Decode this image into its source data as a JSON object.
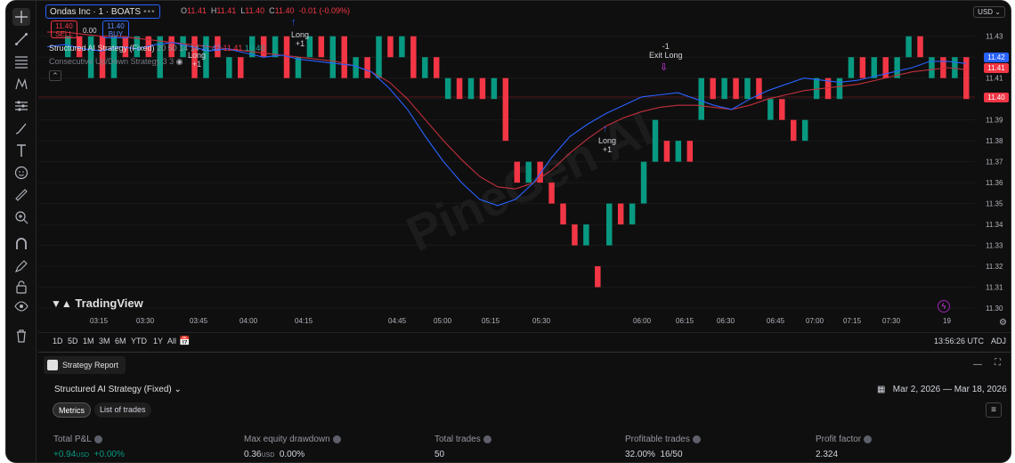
{
  "symbol": {
    "title": "Ondas Inc · 1 · BOATS",
    "ohlc_open_label": "O",
    "ohlc_open": "11.41",
    "ohlc_high_label": "H",
    "ohlc_high": "11.41",
    "ohlc_low_label": "L",
    "ohlc_low": "11.40",
    "ohlc_close_label": "C",
    "ohlc_close": "11.40",
    "change": "-0.01 (-0.09%)"
  },
  "trade": {
    "sell_price": "11.40",
    "sell_label": "SELL",
    "spread": "0.00",
    "buy_price": "11.40",
    "buy_label": "BUY"
  },
  "indicators": {
    "strategy_name": "Structured AI Strategy (Fixed)",
    "strategy_params": "20 50 14 14",
    "strategy_values": [
      "11.42",
      "11.41",
      "10.40"
    ],
    "second_name": "Consecutive Up/Down Strategy 3 3"
  },
  "price_axis": {
    "currency": "USD",
    "ticks": [
      "11.43",
      "11.42",
      "11.41",
      "11.40",
      "11.39",
      "11.38",
      "11.37",
      "11.36",
      "11.35",
      "11.34",
      "11.33",
      "11.32",
      "11.31",
      "11.30"
    ],
    "tag_blue": "11.42",
    "tag_red": "11.41",
    "tag_last": "11.40"
  },
  "time_axis": {
    "labels": [
      "03:15",
      "03:30",
      "03:45",
      "04:00",
      "04:15",
      "04:45",
      "05:00",
      "05:15",
      "05:30",
      "06:00",
      "06:15",
      "06:30",
      "06:45",
      "07:00",
      "07:15",
      "07:30",
      "19"
    ]
  },
  "annotations": {
    "long1_label": "Long",
    "long1_qty": "+1",
    "long2_label": "Long",
    "long2_qty": "+1",
    "long3_label": "Long",
    "long3_qty": "+1",
    "exit_qty": "-1",
    "exit_label": "Exit Long"
  },
  "watermark": "PineGen AI",
  "branding": "TradingView",
  "range": {
    "buttons": [
      "1D",
      "5D",
      "1M",
      "3M",
      "6M",
      "YTD",
      "1Y",
      "All"
    ],
    "clock": "13:56:26 UTC",
    "adj": "ADJ"
  },
  "report": {
    "tab_label": "Strategy Report",
    "strategy_select": "Structured AI Strategy (Fixed)",
    "date_range": "Mar 2, 2026 — Mar 18, 2026",
    "tabs": [
      "Metrics",
      "List of trades"
    ],
    "metrics": [
      {
        "label": "Total P&L",
        "value": "+0.94",
        "unit": "USD",
        "extra": "+0.00%"
      },
      {
        "label": "Max equity drawdown",
        "value": "0.36",
        "unit": "USD",
        "extra": "0.00%"
      },
      {
        "label": "Total trades",
        "value": "50",
        "unit": "",
        "extra": ""
      },
      {
        "label": "Profitable trades",
        "value": "32.00%",
        "unit": "",
        "extra": "16/50"
      },
      {
        "label": "Profit factor",
        "value": "2.324",
        "unit": "",
        "extra": ""
      }
    ]
  },
  "colors": {
    "up": "#089981",
    "down": "#f23645",
    "ma_fast": "#2962ff",
    "ma_slow": "#c2303c",
    "accent": "#2962ff"
  },
  "chart_data": {
    "type": "candlestick",
    "ylim": [
      11.3,
      11.435
    ],
    "candles": [
      {
        "o": 11.42,
        "c": 11.43
      },
      {
        "o": 11.43,
        "c": 11.42
      },
      {
        "o": 11.41,
        "c": 11.43
      },
      {
        "o": 11.43,
        "c": 11.41
      },
      {
        "o": 11.41,
        "c": 11.43
      },
      {
        "o": 11.43,
        "c": 11.42
      },
      {
        "o": 11.42,
        "c": 11.43
      },
      {
        "o": 11.43,
        "c": 11.42
      },
      {
        "o": 11.41,
        "c": 11.43
      },
      {
        "o": 11.43,
        "c": 11.42
      },
      {
        "o": 11.42,
        "c": 11.43
      },
      {
        "o": 11.43,
        "c": 11.41
      },
      {
        "o": 11.41,
        "c": 11.43
      },
      {
        "o": 11.43,
        "c": 11.42
      },
      {
        "o": 11.41,
        "c": 11.42
      },
      {
        "o": 11.42,
        "c": 11.41
      },
      {
        "o": 11.42,
        "c": 11.43
      },
      {
        "o": 11.43,
        "c": 11.42
      },
      {
        "o": 11.42,
        "c": 11.43
      },
      {
        "o": 11.43,
        "c": 11.41
      },
      {
        "o": 11.41,
        "c": 11.42
      },
      {
        "o": 11.42,
        "c": 11.43
      },
      {
        "o": 11.43,
        "c": 11.42
      },
      {
        "o": 11.41,
        "c": 11.43
      },
      {
        "o": 11.43,
        "c": 11.41
      },
      {
        "o": 11.41,
        "c": 11.42
      },
      {
        "o": 11.42,
        "c": 11.41
      },
      {
        "o": 11.41,
        "c": 11.43
      },
      {
        "o": 11.43,
        "c": 11.42
      },
      {
        "o": 11.42,
        "c": 11.43
      },
      {
        "o": 11.43,
        "c": 11.41
      },
      {
        "o": 11.41,
        "c": 11.42
      },
      {
        "o": 11.42,
        "c": 11.41
      },
      {
        "o": 11.4,
        "c": 11.41
      },
      {
        "o": 11.41,
        "c": 11.4
      },
      {
        "o": 11.4,
        "c": 11.41
      },
      {
        "o": 11.41,
        "c": 11.4
      },
      {
        "o": 11.4,
        "c": 11.41
      },
      {
        "o": 11.41,
        "c": 11.38
      },
      {
        "o": 11.37,
        "c": 11.36
      },
      {
        "o": 11.36,
        "c": 11.37
      },
      {
        "o": 11.37,
        "c": 11.36
      },
      {
        "o": 11.36,
        "c": 11.35
      },
      {
        "o": 11.35,
        "c": 11.34
      },
      {
        "o": 11.34,
        "c": 11.33
      },
      {
        "o": 11.33,
        "c": 11.34
      },
      {
        "o": 11.32,
        "c": 11.31
      },
      {
        "o": 11.33,
        "c": 11.35
      },
      {
        "o": 11.35,
        "c": 11.34
      },
      {
        "o": 11.34,
        "c": 11.35
      },
      {
        "o": 11.35,
        "c": 11.37
      },
      {
        "o": 11.37,
        "c": 11.39
      },
      {
        "o": 11.38,
        "c": 11.37
      },
      {
        "o": 11.37,
        "c": 11.38
      },
      {
        "o": 11.38,
        "c": 11.37
      },
      {
        "o": 11.39,
        "c": 11.41
      },
      {
        "o": 11.41,
        "c": 11.4
      },
      {
        "o": 11.4,
        "c": 11.41
      },
      {
        "o": 11.41,
        "c": 11.4
      },
      {
        "o": 11.4,
        "c": 11.41
      },
      {
        "o": 11.41,
        "c": 11.4
      },
      {
        "o": 11.39,
        "c": 11.4
      },
      {
        "o": 11.4,
        "c": 11.39
      },
      {
        "o": 11.39,
        "c": 11.38
      },
      {
        "o": 11.38,
        "c": 11.39
      },
      {
        "o": 11.4,
        "c": 11.41
      },
      {
        "o": 11.41,
        "c": 11.4
      },
      {
        "o": 11.4,
        "c": 11.41
      },
      {
        "o": 11.41,
        "c": 11.42
      },
      {
        "o": 11.42,
        "c": 11.41
      },
      {
        "o": 11.41,
        "c": 11.42
      },
      {
        "o": 11.42,
        "c": 11.41
      },
      {
        "o": 11.41,
        "c": 11.42
      },
      {
        "o": 11.42,
        "c": 11.43
      },
      {
        "o": 11.43,
        "c": 11.42
      },
      {
        "o": 11.41,
        "c": 11.42
      },
      {
        "o": 11.42,
        "c": 11.41
      },
      {
        "o": 11.41,
        "c": 11.42
      },
      {
        "o": 11.42,
        "c": 11.4
      }
    ],
    "ma_fast": [
      11.425,
      11.426,
      11.424,
      11.423,
      11.425,
      11.424,
      11.426,
      11.427,
      11.425,
      11.423,
      11.424,
      11.422,
      11.42,
      11.421,
      11.419,
      11.418,
      11.417,
      11.416,
      11.413,
      11.405,
      11.395,
      11.382,
      11.37,
      11.36,
      11.352,
      11.349,
      11.352,
      11.36,
      11.372,
      11.382,
      11.388,
      11.393,
      11.397,
      11.401,
      11.402,
      11.403,
      11.4,
      11.397,
      11.395,
      11.4,
      11.404,
      11.407,
      11.41,
      11.409,
      11.408,
      11.409,
      11.411,
      11.413,
      11.415,
      11.418,
      11.418,
      11.417
    ],
    "ma_slow": [
      11.432,
      11.432,
      11.431,
      11.43,
      11.43,
      11.429,
      11.428,
      11.427,
      11.426,
      11.425,
      11.424,
      11.423,
      11.422,
      11.421,
      11.42,
      11.419,
      11.418,
      11.416,
      11.413,
      11.408,
      11.4,
      11.39,
      11.38,
      11.371,
      11.363,
      11.358,
      11.357,
      11.36,
      11.366,
      11.374,
      11.381,
      11.387,
      11.391,
      11.394,
      11.396,
      11.397,
      11.397,
      11.396,
      11.395,
      11.397,
      11.4,
      11.402,
      11.404,
      11.405,
      11.406,
      11.407,
      11.409,
      11.411,
      11.413,
      11.414,
      11.415,
      11.414
    ]
  }
}
